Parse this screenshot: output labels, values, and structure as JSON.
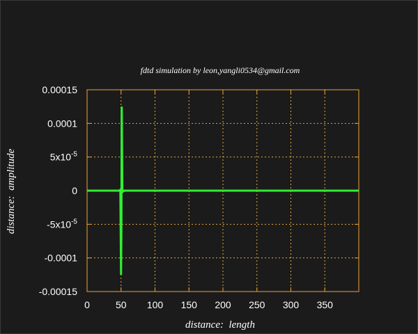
{
  "chart_data": {
    "type": "line",
    "title": "fdtd simulation by leon,yangli0534@gmail.com",
    "xlabel": "distance:  length",
    "ylabel": "distance:  amplitude",
    "xlim": [
      0,
      400
    ],
    "ylim": [
      -0.00015,
      0.00015
    ],
    "x_ticks": [
      {
        "value": 0,
        "label": "0"
      },
      {
        "value": 50,
        "label": "50"
      },
      {
        "value": 100,
        "label": "100"
      },
      {
        "value": 150,
        "label": "150"
      },
      {
        "value": 200,
        "label": "200"
      },
      {
        "value": 250,
        "label": "250"
      },
      {
        "value": 300,
        "label": "300"
      },
      {
        "value": 350,
        "label": "350"
      }
    ],
    "y_ticks": [
      {
        "value": 0.00015,
        "label": "0.00015"
      },
      {
        "value": 0.0001,
        "label": "0.0001"
      },
      {
        "value": 5e-05,
        "label": "5x10",
        "exp": "-5"
      },
      {
        "value": 0,
        "label": "0"
      },
      {
        "value": -5e-05,
        "label": "-5x10",
        "exp": "-5"
      },
      {
        "value": -0.0001,
        "label": "-0.0001"
      },
      {
        "value": -0.00015,
        "label": "-0.00015"
      }
    ],
    "grid": true,
    "series": [
      {
        "color": "#33ee33",
        "x": [
          0,
          48,
          49,
          50,
          50.5,
          51,
          51.5,
          52,
          53,
          54,
          400
        ],
        "y": [
          0,
          0,
          1.2e-06,
          -0.000125,
          -6.2e-05,
          0.000125,
          6.2e-05,
          0,
          -1.2e-06,
          0,
          0
        ]
      }
    ]
  },
  "colors": {
    "background": "#1b1b1b",
    "axes_border": "#f0a030",
    "grid": "#e8a840",
    "series": "#33ee33",
    "text": "#ffffff"
  }
}
